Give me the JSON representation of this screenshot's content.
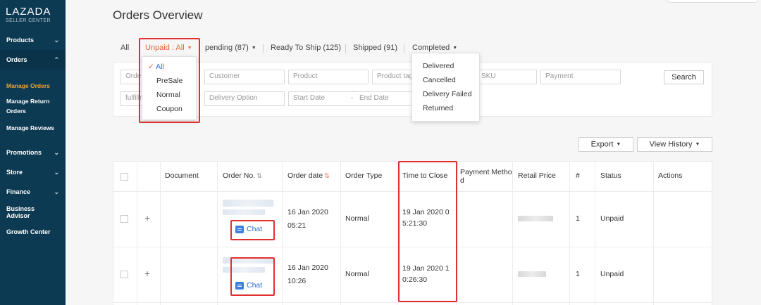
{
  "sidebar": {
    "brand": "LAZADA",
    "sub": "SELLER CENTER",
    "items": [
      {
        "label": "Products"
      },
      {
        "label": "Orders"
      },
      {
        "label": "Promotions"
      },
      {
        "label": "Store"
      },
      {
        "label": "Finance"
      },
      {
        "label": "Business Advisor"
      },
      {
        "label": "Growth Center"
      }
    ],
    "orders_sub": [
      {
        "label": "Manage Orders"
      },
      {
        "label": "Manage Return"
      },
      {
        "label": "Orders"
      },
      {
        "label": "Manage Reviews"
      }
    ]
  },
  "page_title": "Orders Overview",
  "tabs": {
    "all": "All",
    "unpaid": "Unpaid : All",
    "pending": "pending (87)",
    "ready": "Ready To Ship (125)",
    "shipped": "Shipped (91)",
    "completed": "Completed"
  },
  "filters": {
    "order": "Order",
    "customer": "Customer",
    "product": "Product",
    "product_tag": "Product tag",
    "sku": "SKU",
    "payment": "Payment",
    "fulfillment": "fulfillm",
    "delivery_option": "Delivery Option",
    "start_date": "Start Date",
    "date_sep": "-",
    "end_date": "End Date",
    "search": "Search"
  },
  "unpaid_menu": {
    "items": [
      "All",
      "PreSale",
      "Normal",
      "Coupon"
    ],
    "selected": "All"
  },
  "completed_menu": {
    "items": [
      "Delivered",
      "Cancelled",
      "Delivery Failed",
      "Returned"
    ]
  },
  "toolbar": {
    "export": "Export",
    "history": "View History"
  },
  "table": {
    "headers": {
      "document": "Document",
      "order_no": "Order No.",
      "order_date": "Order date",
      "order_type": "Order Type",
      "time_close": "Time to Close",
      "payment_1": "Payment Metho",
      "payment_2": "d",
      "retail": "Retail Price",
      "count": "#",
      "status": "Status",
      "actions": "Actions"
    },
    "rows": [
      {
        "date_1": "16 Jan 2020",
        "date_2": "05:21",
        "type": "Normal",
        "close_1": "19 Jan 2020 0",
        "close_2": "5:21:30",
        "qty": "1",
        "status": "Unpaid",
        "chat": "Chat"
      },
      {
        "date_1": "16 Jan 2020",
        "date_2": "10:26",
        "type": "Normal",
        "close_1": "19 Jan 2020 1",
        "close_2": "0:26:30",
        "qty": "1",
        "status": "Unpaid",
        "chat": "Chat"
      }
    ]
  },
  "colors": {
    "sidebar_bg": "#0c3a52",
    "accent_orange": "#e0663a",
    "link_blue": "#2a6fd3",
    "highlight_red": "#e03030"
  }
}
